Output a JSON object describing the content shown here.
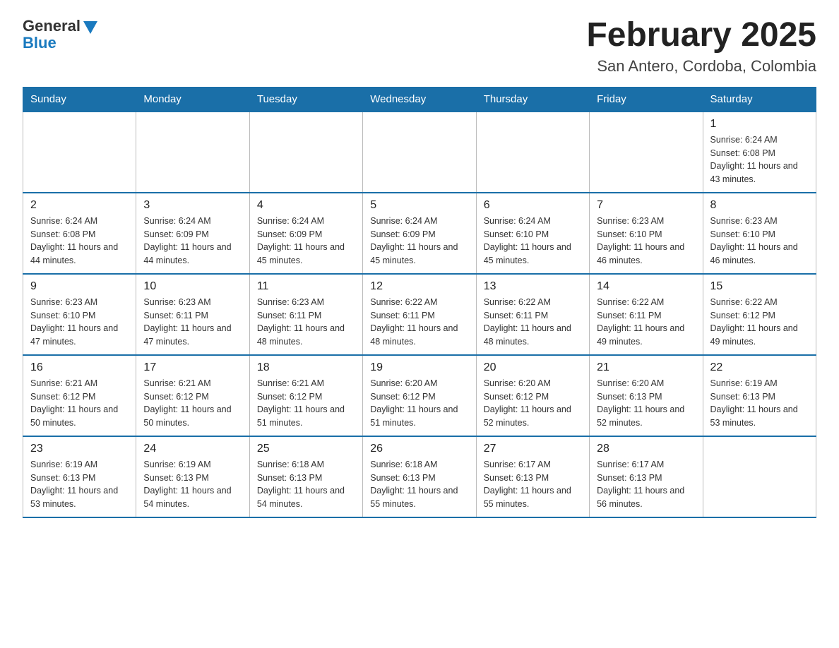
{
  "logo": {
    "general": "General",
    "blue": "Blue"
  },
  "title": "February 2025",
  "subtitle": "San Antero, Cordoba, Colombia",
  "days_of_week": [
    "Sunday",
    "Monday",
    "Tuesday",
    "Wednesday",
    "Thursday",
    "Friday",
    "Saturday"
  ],
  "weeks": [
    [
      {
        "day": "",
        "info": ""
      },
      {
        "day": "",
        "info": ""
      },
      {
        "day": "",
        "info": ""
      },
      {
        "day": "",
        "info": ""
      },
      {
        "day": "",
        "info": ""
      },
      {
        "day": "",
        "info": ""
      },
      {
        "day": "1",
        "info": "Sunrise: 6:24 AM\nSunset: 6:08 PM\nDaylight: 11 hours and 43 minutes."
      }
    ],
    [
      {
        "day": "2",
        "info": "Sunrise: 6:24 AM\nSunset: 6:08 PM\nDaylight: 11 hours and 44 minutes."
      },
      {
        "day": "3",
        "info": "Sunrise: 6:24 AM\nSunset: 6:09 PM\nDaylight: 11 hours and 44 minutes."
      },
      {
        "day": "4",
        "info": "Sunrise: 6:24 AM\nSunset: 6:09 PM\nDaylight: 11 hours and 45 minutes."
      },
      {
        "day": "5",
        "info": "Sunrise: 6:24 AM\nSunset: 6:09 PM\nDaylight: 11 hours and 45 minutes."
      },
      {
        "day": "6",
        "info": "Sunrise: 6:24 AM\nSunset: 6:10 PM\nDaylight: 11 hours and 45 minutes."
      },
      {
        "day": "7",
        "info": "Sunrise: 6:23 AM\nSunset: 6:10 PM\nDaylight: 11 hours and 46 minutes."
      },
      {
        "day": "8",
        "info": "Sunrise: 6:23 AM\nSunset: 6:10 PM\nDaylight: 11 hours and 46 minutes."
      }
    ],
    [
      {
        "day": "9",
        "info": "Sunrise: 6:23 AM\nSunset: 6:10 PM\nDaylight: 11 hours and 47 minutes."
      },
      {
        "day": "10",
        "info": "Sunrise: 6:23 AM\nSunset: 6:11 PM\nDaylight: 11 hours and 47 minutes."
      },
      {
        "day": "11",
        "info": "Sunrise: 6:23 AM\nSunset: 6:11 PM\nDaylight: 11 hours and 48 minutes."
      },
      {
        "day": "12",
        "info": "Sunrise: 6:22 AM\nSunset: 6:11 PM\nDaylight: 11 hours and 48 minutes."
      },
      {
        "day": "13",
        "info": "Sunrise: 6:22 AM\nSunset: 6:11 PM\nDaylight: 11 hours and 48 minutes."
      },
      {
        "day": "14",
        "info": "Sunrise: 6:22 AM\nSunset: 6:11 PM\nDaylight: 11 hours and 49 minutes."
      },
      {
        "day": "15",
        "info": "Sunrise: 6:22 AM\nSunset: 6:12 PM\nDaylight: 11 hours and 49 minutes."
      }
    ],
    [
      {
        "day": "16",
        "info": "Sunrise: 6:21 AM\nSunset: 6:12 PM\nDaylight: 11 hours and 50 minutes."
      },
      {
        "day": "17",
        "info": "Sunrise: 6:21 AM\nSunset: 6:12 PM\nDaylight: 11 hours and 50 minutes."
      },
      {
        "day": "18",
        "info": "Sunrise: 6:21 AM\nSunset: 6:12 PM\nDaylight: 11 hours and 51 minutes."
      },
      {
        "day": "19",
        "info": "Sunrise: 6:20 AM\nSunset: 6:12 PM\nDaylight: 11 hours and 51 minutes."
      },
      {
        "day": "20",
        "info": "Sunrise: 6:20 AM\nSunset: 6:12 PM\nDaylight: 11 hours and 52 minutes."
      },
      {
        "day": "21",
        "info": "Sunrise: 6:20 AM\nSunset: 6:13 PM\nDaylight: 11 hours and 52 minutes."
      },
      {
        "day": "22",
        "info": "Sunrise: 6:19 AM\nSunset: 6:13 PM\nDaylight: 11 hours and 53 minutes."
      }
    ],
    [
      {
        "day": "23",
        "info": "Sunrise: 6:19 AM\nSunset: 6:13 PM\nDaylight: 11 hours and 53 minutes."
      },
      {
        "day": "24",
        "info": "Sunrise: 6:19 AM\nSunset: 6:13 PM\nDaylight: 11 hours and 54 minutes."
      },
      {
        "day": "25",
        "info": "Sunrise: 6:18 AM\nSunset: 6:13 PM\nDaylight: 11 hours and 54 minutes."
      },
      {
        "day": "26",
        "info": "Sunrise: 6:18 AM\nSunset: 6:13 PM\nDaylight: 11 hours and 55 minutes."
      },
      {
        "day": "27",
        "info": "Sunrise: 6:17 AM\nSunset: 6:13 PM\nDaylight: 11 hours and 55 minutes."
      },
      {
        "day": "28",
        "info": "Sunrise: 6:17 AM\nSunset: 6:13 PM\nDaylight: 11 hours and 56 minutes."
      },
      {
        "day": "",
        "info": ""
      }
    ]
  ]
}
